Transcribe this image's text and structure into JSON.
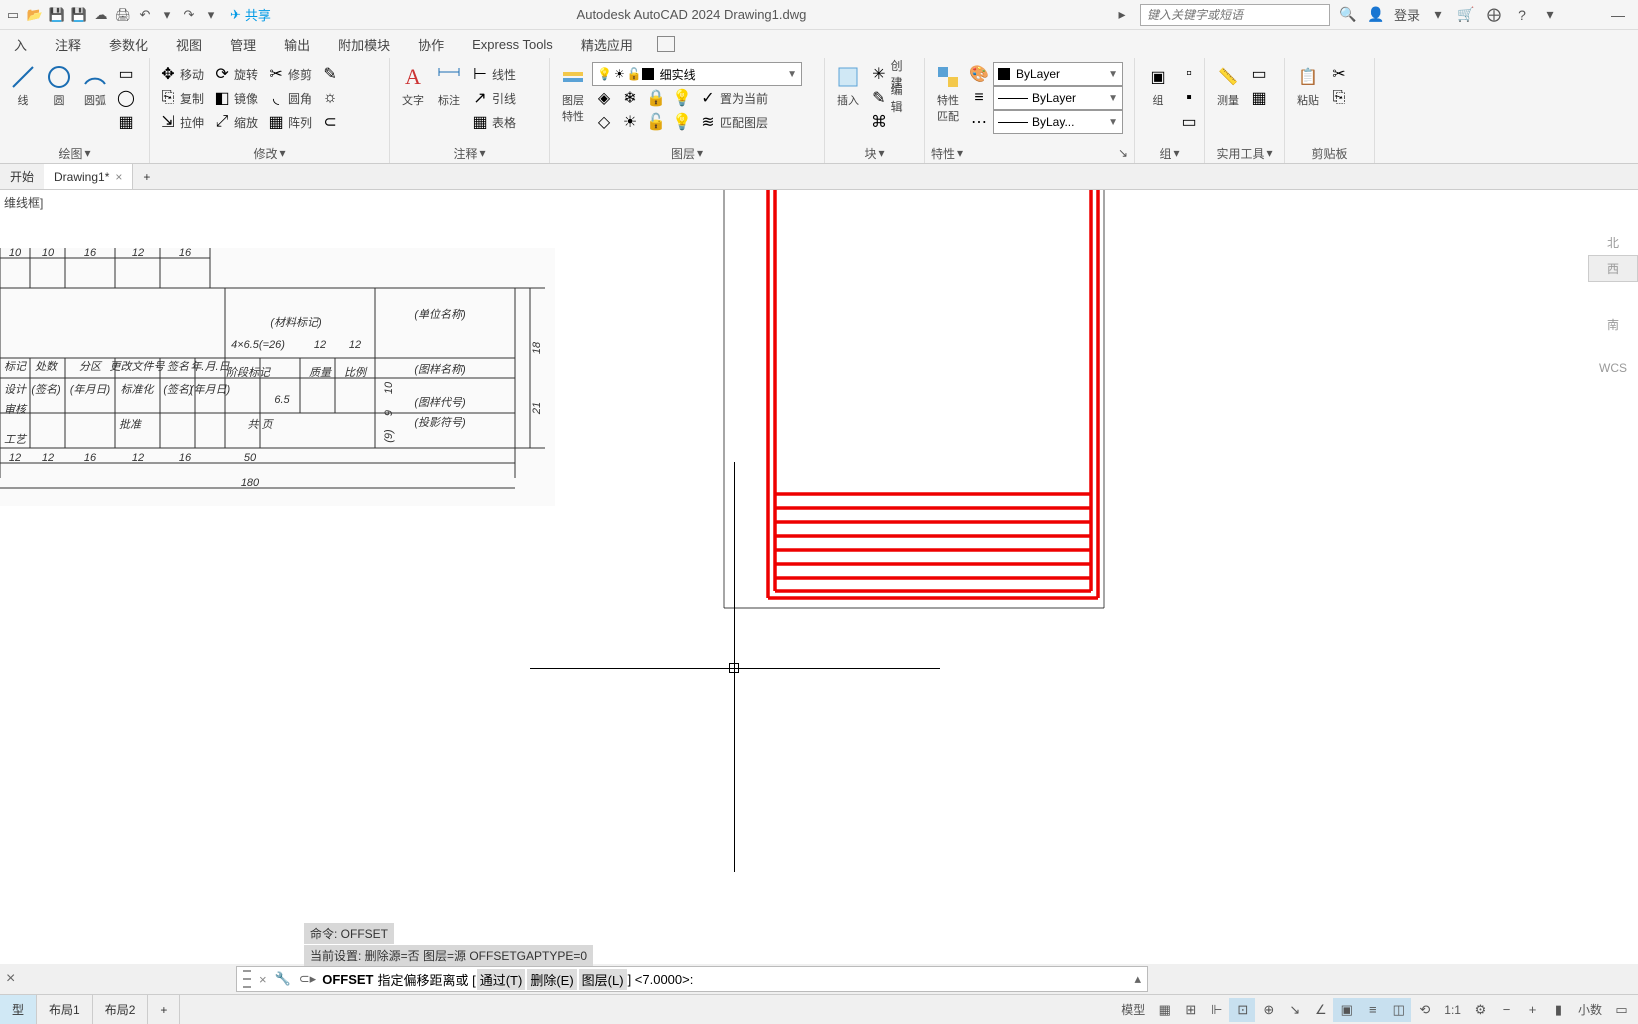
{
  "titlebar": {
    "app_title": "Autodesk AutoCAD 2024   Drawing1.dwg",
    "share": "共享",
    "search_placeholder": "键入关键字或短语",
    "signin": "登录"
  },
  "menu": {
    "items": [
      "入",
      "注释",
      "参数化",
      "视图",
      "管理",
      "输出",
      "附加模块",
      "协作",
      "Express Tools",
      "精选应用"
    ]
  },
  "ribbon": {
    "draw": {
      "title": "绘图",
      "line": "线",
      "circle": "圆",
      "arc": "圆弧"
    },
    "modify": {
      "title": "修改",
      "move": "移动",
      "rotate": "旋转",
      "trim": "修剪",
      "copy": "复制",
      "mirror": "镜像",
      "fillet": "圆角",
      "stretch": "拉伸",
      "scale": "缩放",
      "array": "阵列"
    },
    "annot": {
      "title": "注释",
      "text": "文字",
      "dim": "标注",
      "linear": "线性",
      "leader": "引线",
      "table": "表格"
    },
    "layers": {
      "title": "图层",
      "props": "图层\n特性",
      "linetype": "细实线",
      "current": "置为当前",
      "match": "匹配图层"
    },
    "block": {
      "title": "块",
      "insert": "插入",
      "create": "创建",
      "edit": "编辑"
    },
    "props": {
      "title": "特性",
      "match": "特性\n匹配",
      "bylayer": "ByLayer",
      "bylayer2": "ByLayer",
      "bylayer3": "ByLay..."
    },
    "groups": {
      "title": "组",
      "group": "组"
    },
    "utils": {
      "title": "实用工具",
      "measure": "测量"
    },
    "clip": {
      "title": "剪贴板",
      "paste": "粘贴"
    }
  },
  "ftabs": {
    "start": "开始",
    "drawing": "Drawing1*"
  },
  "viewport": {
    "label": "维线框]",
    "north": "北",
    "west": "西",
    "wcs": "WCS"
  },
  "cmd": {
    "hist1": "命令:   OFFSET",
    "hist2": "当前设置: 删除源=否  图层=源  OFFSETGAPTYPE=0",
    "name": "OFFSET",
    "prompt": "指定偏移距离或 [",
    "opt1": "通过(T)",
    "opt2": "删除(E)",
    "opt3": "图层(L)",
    "suffix": "] <7.0000>:"
  },
  "layout": {
    "model": "型",
    "l1": "布局1",
    "l2": "布局2"
  },
  "status": {
    "model": "模型",
    "scale": "1:1",
    "decimal": "小数"
  }
}
